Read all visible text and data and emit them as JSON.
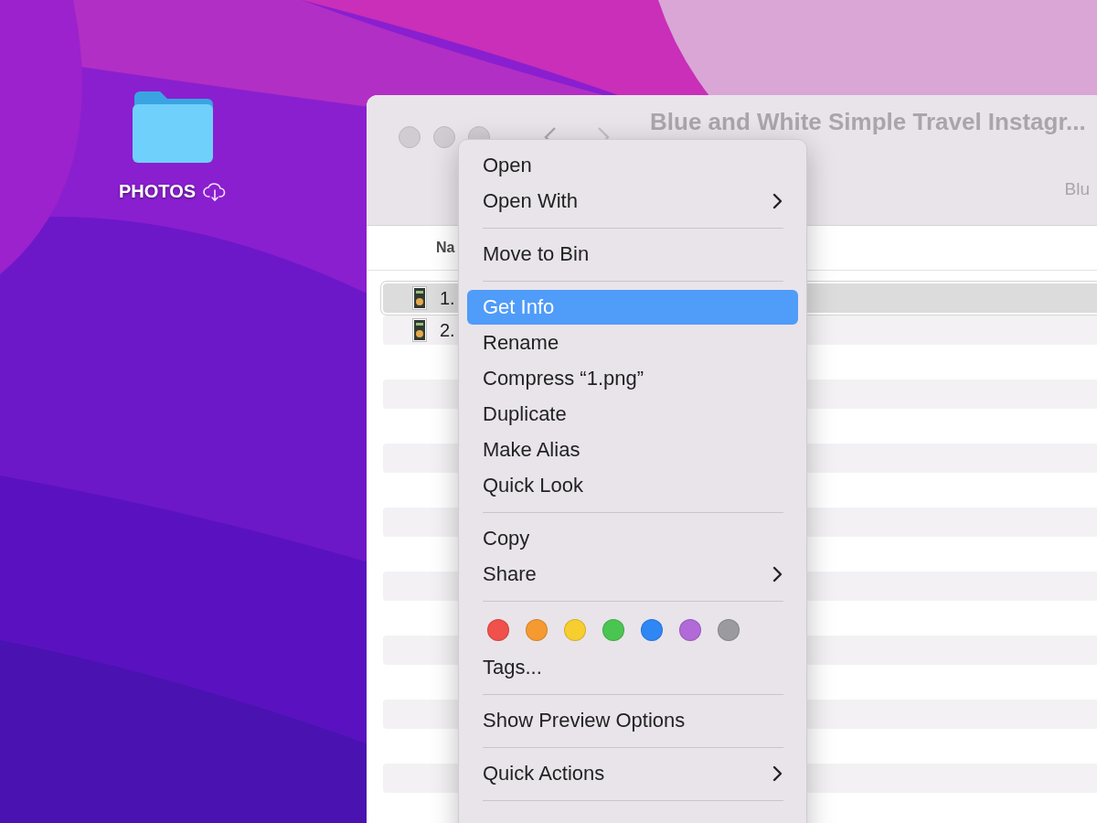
{
  "desktop_icon": {
    "label": "PHOTOS"
  },
  "window": {
    "title": "Blue and White Simple Travel Instagr...",
    "toolbar_label": "Blu",
    "columns": [
      "Na"
    ],
    "rows": [
      {
        "name": "1.",
        "selected": true
      },
      {
        "name": "2.",
        "selected": false
      }
    ]
  },
  "context_menu": {
    "items": [
      {
        "kind": "item",
        "label": "Open",
        "submenu": false,
        "selected": false
      },
      {
        "kind": "item",
        "label": "Open With",
        "submenu": true,
        "selected": false
      },
      {
        "kind": "separator"
      },
      {
        "kind": "item",
        "label": "Move to Bin",
        "submenu": false,
        "selected": false
      },
      {
        "kind": "separator"
      },
      {
        "kind": "item",
        "label": "Get Info",
        "submenu": false,
        "selected": true
      },
      {
        "kind": "item",
        "label": "Rename",
        "submenu": false,
        "selected": false
      },
      {
        "kind": "item",
        "label": "Compress “1.png”",
        "submenu": false,
        "selected": false
      },
      {
        "kind": "item",
        "label": "Duplicate",
        "submenu": false,
        "selected": false
      },
      {
        "kind": "item",
        "label": "Make Alias",
        "submenu": false,
        "selected": false
      },
      {
        "kind": "item",
        "label": "Quick Look",
        "submenu": false,
        "selected": false
      },
      {
        "kind": "separator"
      },
      {
        "kind": "item",
        "label": "Copy",
        "submenu": false,
        "selected": false
      },
      {
        "kind": "item",
        "label": "Share",
        "submenu": true,
        "selected": false
      },
      {
        "kind": "separator"
      },
      {
        "kind": "tags",
        "colors": [
          {
            "color": "#f0514a"
          },
          {
            "color": "#f59a30"
          },
          {
            "color": "#f7ce2f"
          },
          {
            "color": "#4bc552"
          },
          {
            "color": "#2f86f5"
          },
          {
            "color": "#b16ad8"
          },
          {
            "color": "#9b9a9f"
          }
        ]
      },
      {
        "kind": "item",
        "label": "Tags...",
        "submenu": false,
        "selected": false
      },
      {
        "kind": "separator"
      },
      {
        "kind": "item",
        "label": "Show Preview Options",
        "submenu": false,
        "selected": false
      },
      {
        "kind": "separator"
      },
      {
        "kind": "item",
        "label": "Quick Actions",
        "submenu": true,
        "selected": false
      },
      {
        "kind": "separator"
      }
    ]
  }
}
